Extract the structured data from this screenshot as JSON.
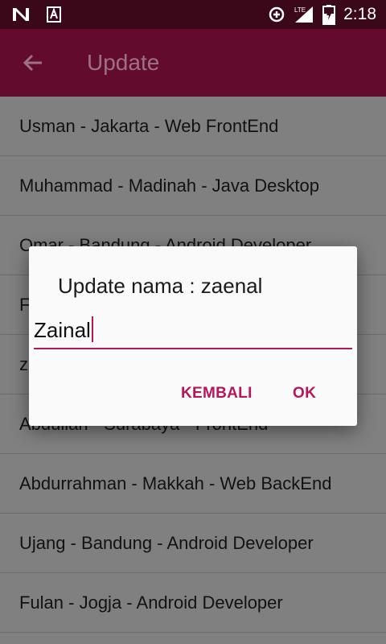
{
  "status_bar": {
    "time": "2:18",
    "network": "LTE",
    "icons": [
      "n-notification-icon",
      "a-notification-icon",
      "data-saver-icon",
      "signal-icon",
      "battery-icon"
    ]
  },
  "app_bar": {
    "title": "Update",
    "back_icon": "arrow-back-icon"
  },
  "list": {
    "items": [
      "Usman - Jakarta - Web FrontEnd",
      "Muhammad - Madinah - Java Desktop",
      "Omar - Bandung - Android Developer",
      "F",
      "z",
      "Abdullah - Surabaya - FrontEnd",
      "Abdurrahman - Makkah - Web BackEnd",
      "Ujang - Bandung - Android Developer",
      "Fulan - Jogja - Android Developer"
    ]
  },
  "dialog": {
    "title": "Update nama : zaenal",
    "input_value": "Zainal",
    "negative_button": "KEMBALI",
    "positive_button": "OK"
  },
  "colors": {
    "app_bar": "#620b2c",
    "status_bar": "#3a0818",
    "accent": "#b7145c",
    "scrim_bg": "#808080"
  }
}
